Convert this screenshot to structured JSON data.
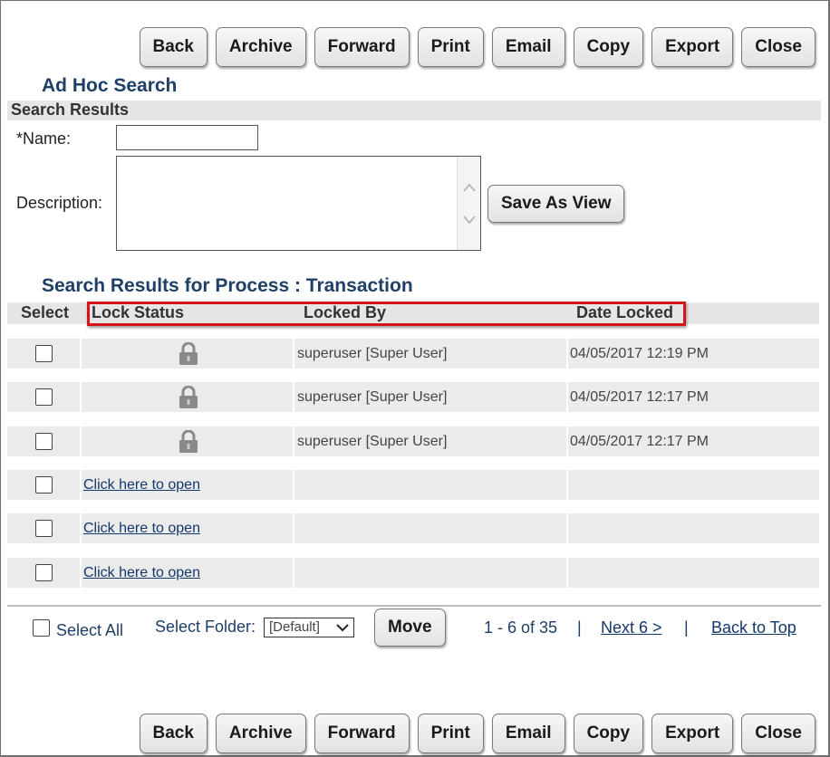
{
  "toolbar": {
    "back": "Back",
    "archive": "Archive",
    "forward": "Forward",
    "print": "Print",
    "email": "Email",
    "copy": "Copy",
    "export": "Export",
    "close": "Close"
  },
  "page": {
    "title": "Ad Hoc Search",
    "section": "Search Results",
    "name_label": "*Name:",
    "name_value": "",
    "description_label": "Description:",
    "description_value": "",
    "save_view": "Save As View",
    "results_title": "Search Results for Process : Transaction"
  },
  "table": {
    "headers": {
      "select": "Select",
      "lock_status": "Lock Status",
      "locked_by": "Locked By",
      "date_locked": "Date Locked"
    },
    "rows": [
      {
        "locked": true,
        "open_link": "",
        "locked_by": "superuser [Super User]",
        "date_locked": "04/05/2017 12:19 PM"
      },
      {
        "locked": true,
        "open_link": "",
        "locked_by": "superuser [Super User]",
        "date_locked": "04/05/2017 12:17 PM"
      },
      {
        "locked": true,
        "open_link": "",
        "locked_by": "superuser [Super User]",
        "date_locked": "04/05/2017 12:17 PM"
      },
      {
        "locked": false,
        "open_link": "Click here to open",
        "locked_by": "",
        "date_locked": ""
      },
      {
        "locked": false,
        "open_link": "Click here to open",
        "locked_by": "",
        "date_locked": ""
      },
      {
        "locked": false,
        "open_link": "Click here to open",
        "locked_by": "",
        "date_locked": ""
      }
    ]
  },
  "footer": {
    "select_all": "Select All",
    "select_folder_label": "Select Folder:",
    "folder_value": "[Default]",
    "move": "Move",
    "range": "1 - 6 of 35",
    "sep": "|",
    "next": "Next 6 >",
    "back_to_top": "Back to Top"
  },
  "colors": {
    "heading": "#1f3f66",
    "highlight": "#d4161c",
    "row_bg": "#ebebeb"
  }
}
